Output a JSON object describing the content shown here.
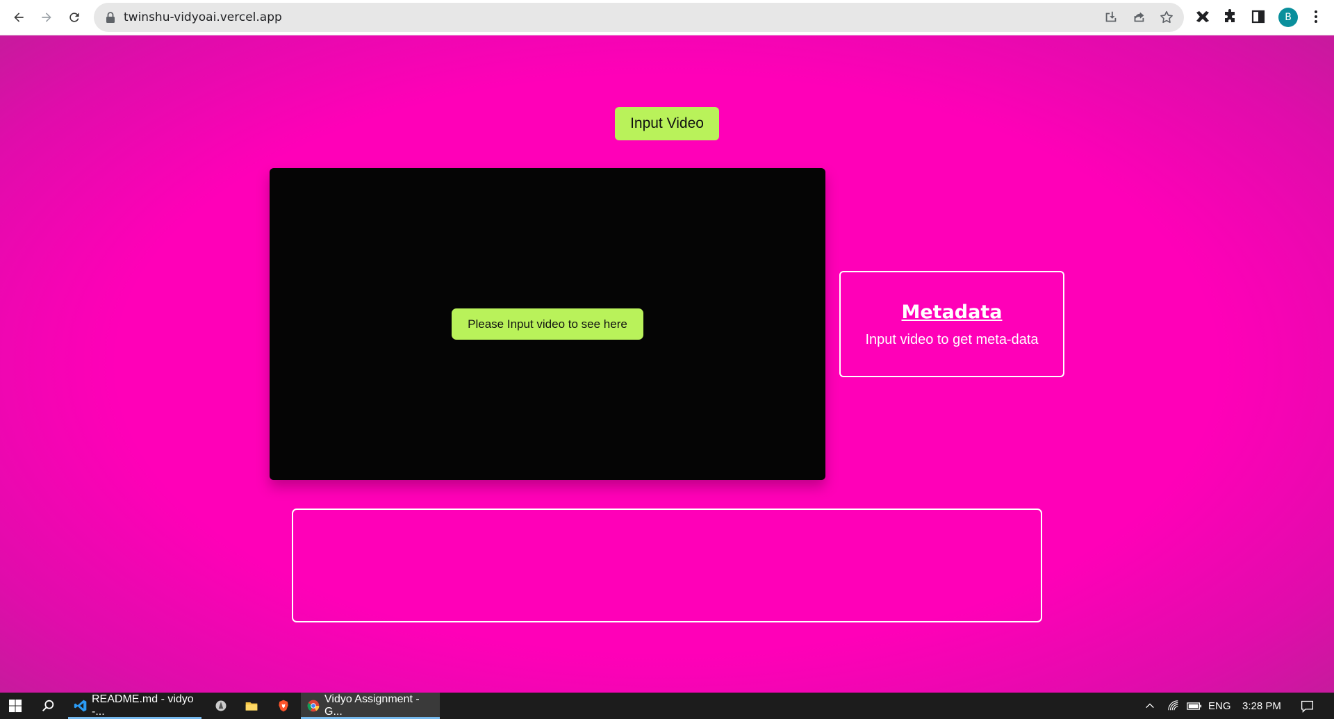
{
  "browser": {
    "url": "twinshu-vidyoai.vercel.app",
    "avatar_letter": "B",
    "icons": [
      "back-icon",
      "forward-icon",
      "reload-icon",
      "lock-icon",
      "install-icon",
      "share-icon",
      "star-icon",
      "extension-puzzle-icon",
      "side-panel-icon",
      "more-menu-icon"
    ]
  },
  "page": {
    "input_button_label": "Input Video",
    "video_placeholder": "Please Input video to see here",
    "metadata": {
      "title": "Metadata",
      "subtitle": "Input video to get meta-data"
    },
    "colors": {
      "background": "#ff00b8",
      "accent_button": "#b9f25a",
      "video_bg": "#050505",
      "border": "#ffffff"
    }
  },
  "taskbar": {
    "apps": [
      {
        "label": "README.md - vidyo -...",
        "icon": "vscode-icon",
        "active": false
      },
      {
        "label": "Vidyo Assignment - G...",
        "icon": "chrome-icon",
        "active": true
      }
    ],
    "language": "ENG",
    "time": "3:28 PM"
  }
}
